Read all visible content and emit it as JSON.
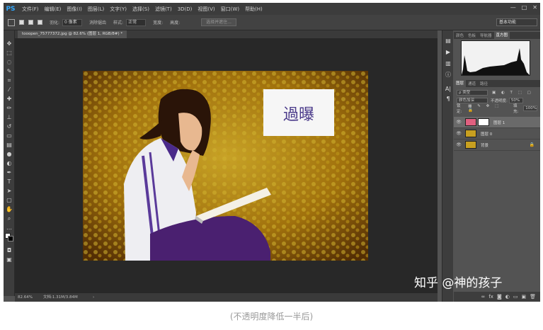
{
  "app": {
    "logo": "PS",
    "window_controls": [
      "—",
      "□",
      "✕"
    ]
  },
  "menubar": {
    "items": [
      "文件(F)",
      "编辑(E)",
      "图像(I)",
      "图层(L)",
      "文字(Y)",
      "选择(S)",
      "滤镜(T)",
      "3D(D)",
      "视图(V)",
      "窗口(W)",
      "帮助(H)"
    ]
  },
  "options_bar": {
    "feather_label": "羽化:",
    "feather_value": "0 像素",
    "antialias_label": "消除锯齿",
    "style_label": "样式:",
    "style_value": "正常",
    "width_label": "宽度:",
    "height_label": "高度:",
    "refine_button": "选择并遮住...",
    "workspace": "基本功能"
  },
  "document": {
    "tab_title": "tooopen_75777372.jpg @ 82.6% (图层 1, RGB/8#) *",
    "zoom": "82.64%",
    "doc_info": "文档:1.31M/3.84M"
  },
  "canvas": {
    "overlay_text": "過曝"
  },
  "panels": {
    "top_tabs": [
      "颜色",
      "色板",
      "导航器",
      "直方图"
    ],
    "layers_tabs": [
      "图层",
      "通道",
      "路径"
    ],
    "kind_filter": "ρ 类型",
    "blend_mode": "颜色加深",
    "opacity_label": "不透明度:",
    "opacity_value": "50%",
    "lock_label": "锁定:",
    "fill_label": "填充:",
    "fill_value": "100%",
    "layers": [
      {
        "name": "图层 1",
        "selected": true,
        "eye": "👁"
      },
      {
        "name": "图层 0",
        "selected": false,
        "eye": "👁"
      },
      {
        "name": "背景",
        "selected": false,
        "eye": "👁"
      }
    ]
  },
  "watermark": "知乎 @神的孩子",
  "caption": "(不透明度降低一半后)"
}
